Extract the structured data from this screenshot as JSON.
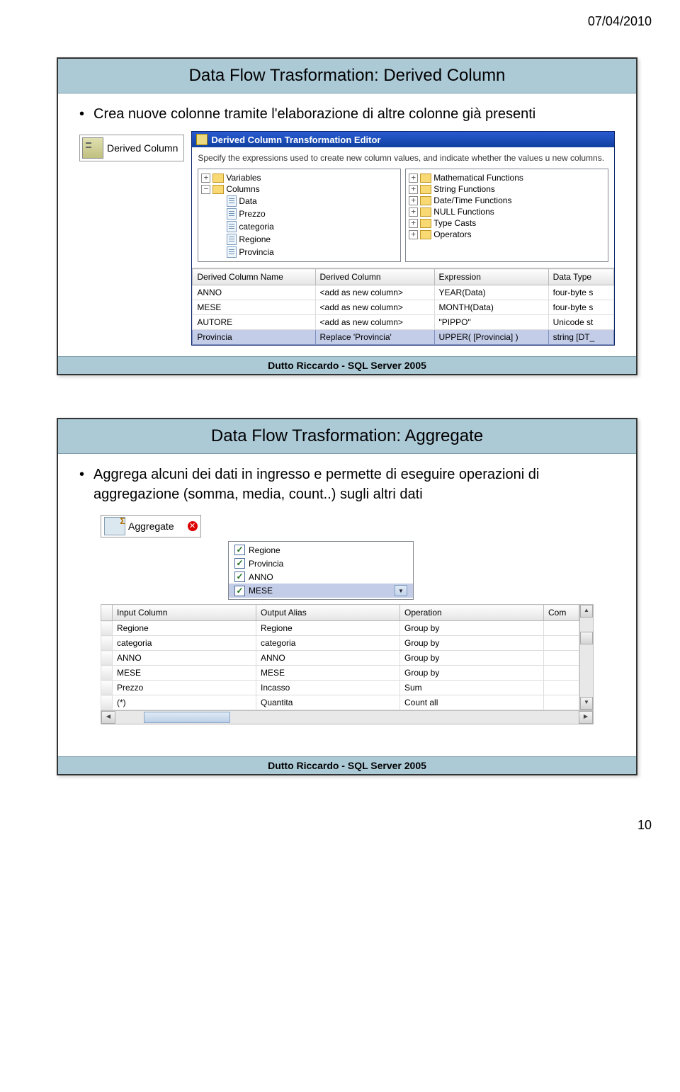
{
  "page": {
    "date": "07/04/2010",
    "number": "10"
  },
  "slide1": {
    "title": "Data Flow Trasformation: Derived Column",
    "bullet": "Crea nuove colonne tramite l'elaborazione di altre colonne già presenti",
    "icon_label": "Derived Column",
    "editor": {
      "title": "Derived Column Transformation Editor",
      "desc": "Specify the expressions used to create new column values, and indicate whether the values u new columns.",
      "left_tree": {
        "variables": "Variables",
        "columns": "Columns",
        "items": [
          "Data",
          "Prezzo",
          "categoria",
          "Regione",
          "Provincia"
        ]
      },
      "right_tree": {
        "items": [
          "Mathematical Functions",
          "String Functions",
          "Date/Time Functions",
          "NULL Functions",
          "Type Casts",
          "Operators"
        ]
      },
      "grid": {
        "headers": [
          "Derived Column Name",
          "Derived Column",
          "Expression",
          "Data Type"
        ],
        "rows": [
          [
            "ANNO",
            "<add as new column>",
            "YEAR(Data)",
            "four-byte s"
          ],
          [
            "MESE",
            "<add as new column>",
            "MONTH(Data)",
            "four-byte s"
          ],
          [
            "AUTORE",
            "<add as new column>",
            "\"PIPPO\"",
            "Unicode st"
          ],
          [
            "Provincia",
            "Replace 'Provincia'",
            "UPPER( [Provincia] )",
            "string [DT_"
          ]
        ]
      }
    },
    "footer": "Dutto Riccardo     -     SQL Server 2005"
  },
  "slide2": {
    "title": "Data Flow Trasformation: Aggregate",
    "bullet": "Aggrega alcuni dei dati in ingresso e permette di eseguire operazioni di aggregazione (somma, media, count..) sugli altri dati",
    "icon_label": "Aggregate",
    "checklist": [
      "Regione",
      "Provincia",
      "ANNO",
      "MESE"
    ],
    "grid": {
      "headers": [
        "Input Column",
        "Output Alias",
        "Operation",
        "Com"
      ],
      "rows": [
        [
          "Regione",
          "Regione",
          "Group by",
          ""
        ],
        [
          "categoria",
          "categoria",
          "Group by",
          ""
        ],
        [
          "ANNO",
          "ANNO",
          "Group by",
          ""
        ],
        [
          "MESE",
          "MESE",
          "Group by",
          ""
        ],
        [
          "Prezzo",
          "Incasso",
          "Sum",
          ""
        ],
        [
          "(*)",
          "Quantita",
          "Count all",
          ""
        ]
      ]
    },
    "footer": "Dutto Riccardo     -     SQL Server 2005"
  }
}
